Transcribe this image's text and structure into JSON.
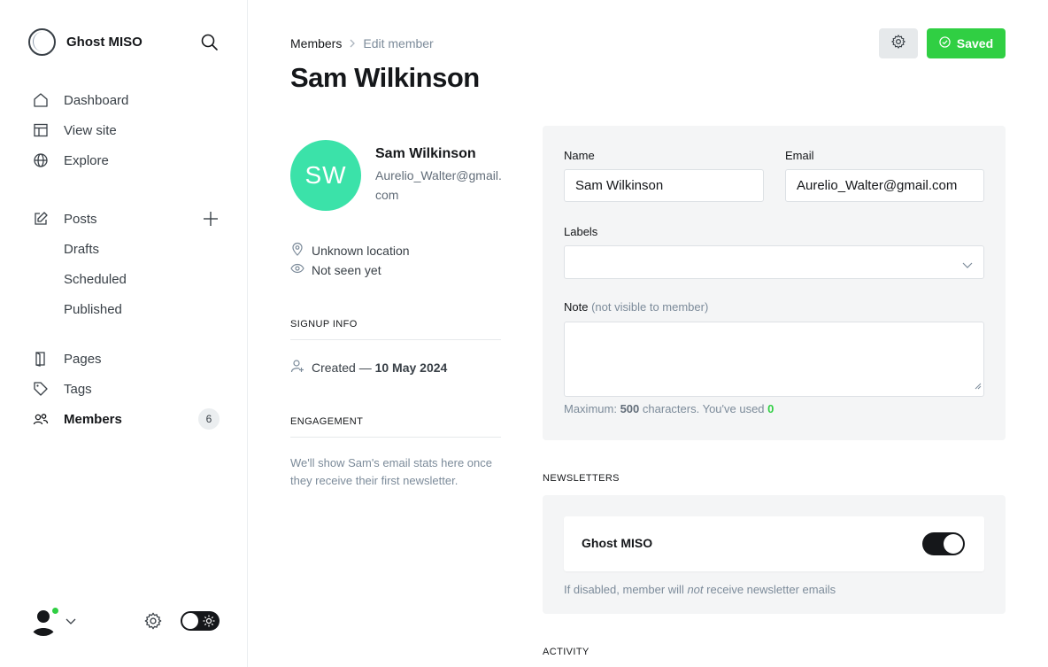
{
  "brand": {
    "title": "Ghost MISO"
  },
  "sidebar": {
    "primary": [
      {
        "label": "Dashboard",
        "icon": "home-icon"
      },
      {
        "label": "View site",
        "icon": "layout-icon"
      },
      {
        "label": "Explore",
        "icon": "globe-icon"
      }
    ],
    "posts": {
      "label": "Posts",
      "icon": "edit-icon"
    },
    "post_subitems": [
      "Drafts",
      "Scheduled",
      "Published"
    ],
    "secondary": [
      {
        "label": "Pages",
        "icon": "page-icon"
      },
      {
        "label": "Tags",
        "icon": "tag-icon"
      },
      {
        "label": "Members",
        "icon": "members-icon",
        "badge": "6",
        "active": true
      }
    ]
  },
  "breadcrumb": {
    "parent": "Members",
    "current": "Edit member"
  },
  "page_title": "Sam Wilkinson",
  "actions": {
    "saved_label": "Saved"
  },
  "member": {
    "initials": "SW",
    "name": "Sam Wilkinson",
    "email": "Aurelio_Walter@gmail.com",
    "location": "Unknown location",
    "seen": "Not seen yet",
    "avatar_color": "#3be2a9"
  },
  "signup": {
    "heading": "SIGNUP INFO",
    "created_prefix": "Created —",
    "created_date": "10 May 2024"
  },
  "engagement": {
    "heading": "ENGAGEMENT",
    "text": "We'll show Sam's email stats here once they receive their first newsletter."
  },
  "form": {
    "name_label": "Name",
    "name_value": "Sam Wilkinson",
    "email_label": "Email",
    "email_value": "Aurelio_Walter@gmail.com",
    "labels_label": "Labels",
    "note_label": "Note",
    "note_muted": "(not visible to member)",
    "hint_prefix": "Maximum:",
    "hint_max": "500",
    "hint_middle": "characters. You've used",
    "hint_used": "0"
  },
  "newsletters": {
    "heading": "NEWSLETTERS",
    "name": "Ghost MISO",
    "subscribed": true,
    "hint_before": "If disabled, member will",
    "hint_emph": "not",
    "hint_after": "receive newsletter emails"
  },
  "activity": {
    "heading": "ACTIVITY"
  },
  "colors": {
    "accent_green": "#30cf43",
    "dark": "#15171a"
  }
}
